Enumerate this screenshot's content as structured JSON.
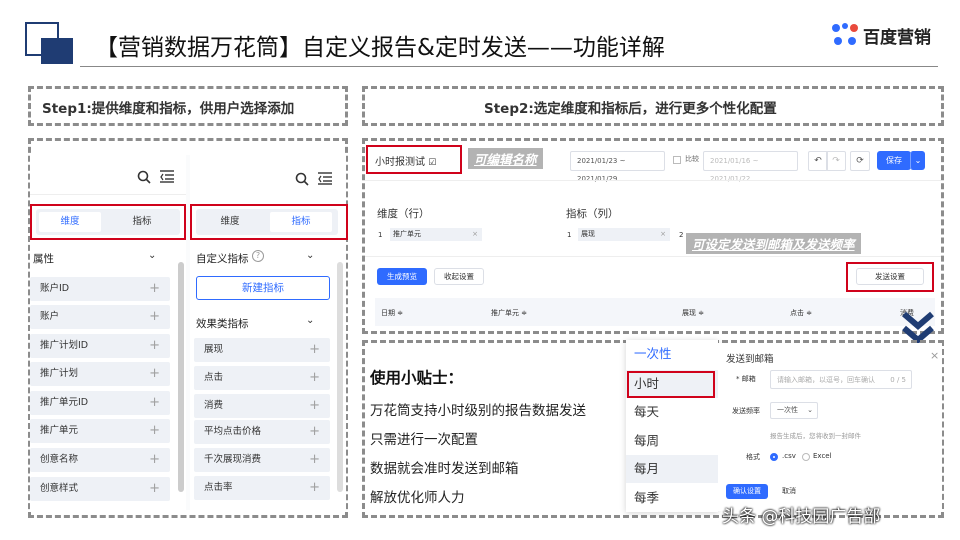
{
  "title": "【营销数据万花筒】自定义报告&定时发送——功能详解",
  "logo_text": "百度营销",
  "step1_label": "Step1:提供维度和指标，供用户选择添加",
  "step2_label": "Step2:选定维度和指标后，进行更多个性化配置",
  "left_panel": {
    "tabs": [
      "维度",
      "指标"
    ],
    "section": "属性",
    "items": [
      "账户ID",
      "账户",
      "推广计划ID",
      "推广计划",
      "推广单元ID",
      "推广单元",
      "创意名称",
      "创意样式"
    ]
  },
  "right_panel": {
    "tabs": [
      "维度",
      "指标"
    ],
    "custom_section": "自定义指标",
    "new_button": "新建指标",
    "effect_section": "效果类指标",
    "items": [
      "展现",
      "点击",
      "消费",
      "平均点击价格",
      "千次展现消费",
      "点击率"
    ]
  },
  "report": {
    "name": "小时报测试",
    "editable_note": "可编辑名称",
    "date_range": "2021/01/23 ~ 2021/01/29",
    "compare_label": "比较",
    "compare_range": "2021/01/16 ~ 2021/01/22",
    "save_label": "保存",
    "dim_label": "维度（行）",
    "metric_label": "指标（列）",
    "dim_index": "1",
    "dim_value": "推广单元",
    "metric_index": "1",
    "metric_value": "展现",
    "metric_index2": "2",
    "send_note": "可设定发送到邮箱及发送频率",
    "preview_button": "生成预览",
    "collapse_button": "收起设置",
    "send_settings_button": "发送设置",
    "columns": [
      "日期 ≑",
      "推广单元 ≑",
      "展现 ≑",
      "点击 ≑",
      "消费"
    ]
  },
  "tips": {
    "title": "使用小贴士：",
    "lines": [
      "万花筒支持小时级别的报告数据发送",
      "只需进行一次配置",
      "数据就会准时发送到邮箱",
      "解放优化师人力"
    ]
  },
  "frequency_options": [
    "一次性",
    "小时",
    "每天",
    "每周",
    "每月",
    "每季"
  ],
  "dialog": {
    "title": "发送到邮箱",
    "email_label": "* 邮箱",
    "email_placeholder": "请输入邮箱，以逗号，回车确认",
    "email_count": "0 / 5",
    "freq_label": "发送频率",
    "freq_value": "一次性",
    "hint": "报告生成后，您将收到一封邮件",
    "format_label": "格式",
    "format_csv": ".csv",
    "format_excel": "Excel",
    "confirm_label": "确认设置",
    "cancel_label": "取消"
  },
  "watermark": "头条 @科技园广告部",
  "colors": {
    "accent": "#2f6bff",
    "red": "#d0021b",
    "navy": "#1f3c73"
  }
}
